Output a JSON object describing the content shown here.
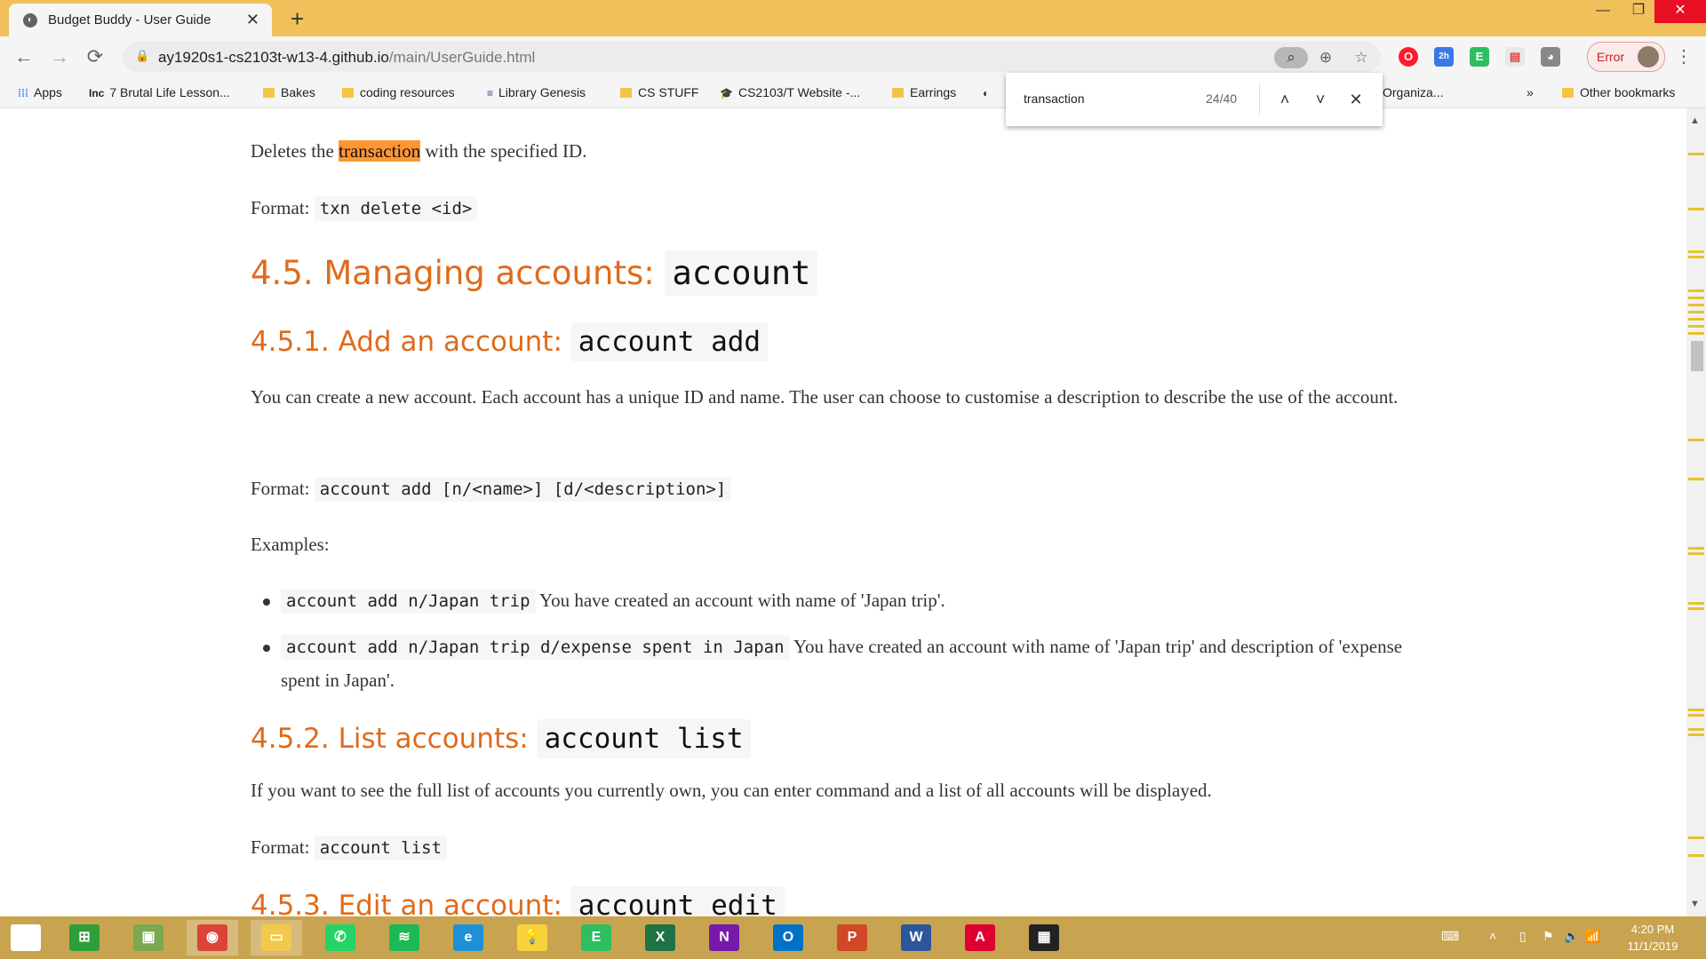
{
  "tab": {
    "title": "Budget Buddy - User Guide",
    "close": "✕",
    "new_tab": "+"
  },
  "window_controls": {
    "minimize": "—",
    "restore": "❐",
    "close": "✕"
  },
  "toolbar": {
    "back": "←",
    "forward": "→",
    "reload": "⟳",
    "lock": "🔒",
    "url_host": "ay1920s1-cs2103t-w13-4.github.io",
    "url_path": "/main/UserGuide.html",
    "zoom_icon": "⊕",
    "star_icon": "☆",
    "extensions": [
      "O",
      "2h",
      "E",
      "▤",
      "◕"
    ],
    "profile_label": "Error",
    "menu": "⋮"
  },
  "bookmarks": [
    {
      "label": "Apps",
      "kind": "apps"
    },
    {
      "label": "7 Brutal Life Lesson...",
      "kind": "inc",
      "icon": "Inc"
    },
    {
      "label": "Bakes",
      "kind": "folder"
    },
    {
      "label": "coding resources",
      "kind": "folder"
    },
    {
      "label": "Library Genesis",
      "kind": "site",
      "icon": "≡"
    },
    {
      "label": "CS STUFF",
      "kind": "folder"
    },
    {
      "label": "CS2103/T Website -...",
      "kind": "site",
      "icon": "🎓"
    },
    {
      "label": "Earrings",
      "kind": "folder"
    },
    {
      "label": "Organiza...",
      "kind": "partial"
    },
    {
      "label": "»",
      "kind": "overflow"
    },
    {
      "label": "Other bookmarks",
      "kind": "folder"
    }
  ],
  "findbar": {
    "query": "transaction",
    "count": "24/40",
    "prev": "˄",
    "next": "˅",
    "close": "✕"
  },
  "doc": {
    "p1_before": "Deletes the ",
    "p1_highlight": "transaction",
    "p1_after": " with the specified ID.",
    "format_label": "Format:",
    "format1_code": "txn delete <id>",
    "h_4_5_text": "4.5. Managing accounts:",
    "h_4_5_code": "account",
    "h_4_5_1_text": "4.5.1. Add an account:",
    "h_4_5_1_code": "account add",
    "p_add_desc": "You can create a new account. Each account has a unique ID and name. The user can choose to customise a description to describe the use of the account.",
    "format2_code": "account add [n/<name>] [d/<description>]",
    "examples_label": "Examples:",
    "ex1_code": "account add n/Japan trip",
    "ex1_text": " You have created an account with name of 'Japan trip'.",
    "ex2_code": "account add n/Japan trip d/expense spent in Japan",
    "ex2_text": " You have created an account with name of 'Japan trip' and description of 'expense spent in Japan'.",
    "h_4_5_2_text": "4.5.2. List accounts:",
    "h_4_5_2_code": "account list",
    "p_list_desc": "If you want to see the full list of accounts you currently own, you can enter command and a list of all accounts will be displayed.",
    "format3_code": "account list",
    "h_4_5_3_text": "4.5.3. Edit an account:",
    "h_4_5_3_code": "account edit"
  },
  "taskbar": {
    "apps": [
      {
        "name": "start",
        "glyph": "⊞",
        "color": "#ffffff"
      },
      {
        "name": "store",
        "glyph": "⊞",
        "color": "#2e9e3a"
      },
      {
        "name": "photos",
        "glyph": "▣",
        "color": "#7ba850"
      },
      {
        "name": "chrome",
        "glyph": "◉",
        "color": "#db4437"
      },
      {
        "name": "files",
        "glyph": "▭",
        "color": "#f2c94c"
      },
      {
        "name": "whatsapp",
        "glyph": "✆",
        "color": "#25d366"
      },
      {
        "name": "spotify",
        "glyph": "≋",
        "color": "#1db954"
      },
      {
        "name": "edge",
        "glyph": "e",
        "color": "#1e90d8"
      },
      {
        "name": "tips",
        "glyph": "💡",
        "color": "#f7d23b"
      },
      {
        "name": "evernote",
        "glyph": "E",
        "color": "#2dbe60"
      },
      {
        "name": "excel",
        "glyph": "X",
        "color": "#1f7244"
      },
      {
        "name": "onenote",
        "glyph": "N",
        "color": "#7719aa"
      },
      {
        "name": "outlook",
        "glyph": "O",
        "color": "#0072c6"
      },
      {
        "name": "powerpoint",
        "glyph": "P",
        "color": "#d24726"
      },
      {
        "name": "word",
        "glyph": "W",
        "color": "#2b579a"
      },
      {
        "name": "angular",
        "glyph": "A",
        "color": "#dd0031"
      },
      {
        "name": "calendar",
        "glyph": "▦",
        "color": "#222222"
      }
    ],
    "tray_icons": [
      "⌨",
      "˄",
      "▯",
      "⚑",
      "🔈",
      "📶"
    ],
    "time": "4:20 PM",
    "date": "11/1/2019"
  },
  "colors": {
    "accent_heading": "#e06b1a",
    "find_highlight": "#ff9632",
    "titlebar": "#f0c15b",
    "taskbar": "#c8a450"
  }
}
